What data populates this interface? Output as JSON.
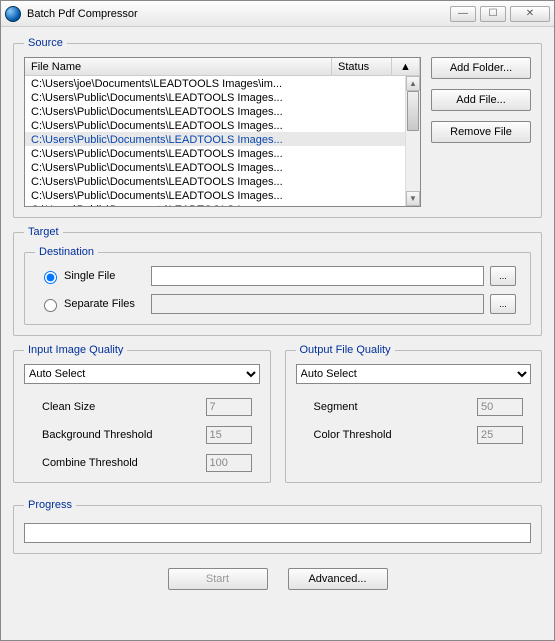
{
  "window": {
    "title": "Batch Pdf Compressor"
  },
  "source": {
    "legend": "Source",
    "columns": {
      "name": "File Name",
      "status": "Status",
      "arrow": "▲"
    },
    "rows": [
      {
        "path": "C:\\Users\\joe\\Documents\\LEADTOOLS Images\\im...",
        "selected": false
      },
      {
        "path": "C:\\Users\\Public\\Documents\\LEADTOOLS Images...",
        "selected": false
      },
      {
        "path": "C:\\Users\\Public\\Documents\\LEADTOOLS Images...",
        "selected": false
      },
      {
        "path": "C:\\Users\\Public\\Documents\\LEADTOOLS Images...",
        "selected": false
      },
      {
        "path": "C:\\Users\\Public\\Documents\\LEADTOOLS Images...",
        "selected": true
      },
      {
        "path": "C:\\Users\\Public\\Documents\\LEADTOOLS Images...",
        "selected": false
      },
      {
        "path": "C:\\Users\\Public\\Documents\\LEADTOOLS Images...",
        "selected": false
      },
      {
        "path": "C:\\Users\\Public\\Documents\\LEADTOOLS Images...",
        "selected": false
      },
      {
        "path": "C:\\Users\\Public\\Documents\\LEADTOOLS Images...",
        "selected": false
      },
      {
        "path": "C:\\Users\\Public\\Documents\\LEADTOOLS Images...",
        "selected": false
      }
    ],
    "buttons": {
      "add_folder": "Add Folder...",
      "add_file": "Add File...",
      "remove_file": "Remove File"
    }
  },
  "target": {
    "legend": "Target",
    "destination": {
      "legend": "Destination",
      "single_file": "Single File",
      "separate_files": "Separate Files",
      "single_value": "",
      "separate_value": "",
      "browse": "..."
    }
  },
  "input_quality": {
    "legend": "Input Image Quality",
    "select": "Auto Select",
    "clean_size_label": "Clean Size",
    "clean_size_value": "7",
    "bg_thresh_label": "Background Threshold",
    "bg_thresh_value": "15",
    "combine_thresh_label": "Combine Threshold",
    "combine_thresh_value": "100"
  },
  "output_quality": {
    "legend": "Output File Quality",
    "select": "Auto Select",
    "segment_label": "Segment",
    "segment_value": "50",
    "color_thresh_label": "Color Threshold",
    "color_thresh_value": "25"
  },
  "progress": {
    "legend": "Progress"
  },
  "footer": {
    "start": "Start",
    "advanced": "Advanced..."
  }
}
